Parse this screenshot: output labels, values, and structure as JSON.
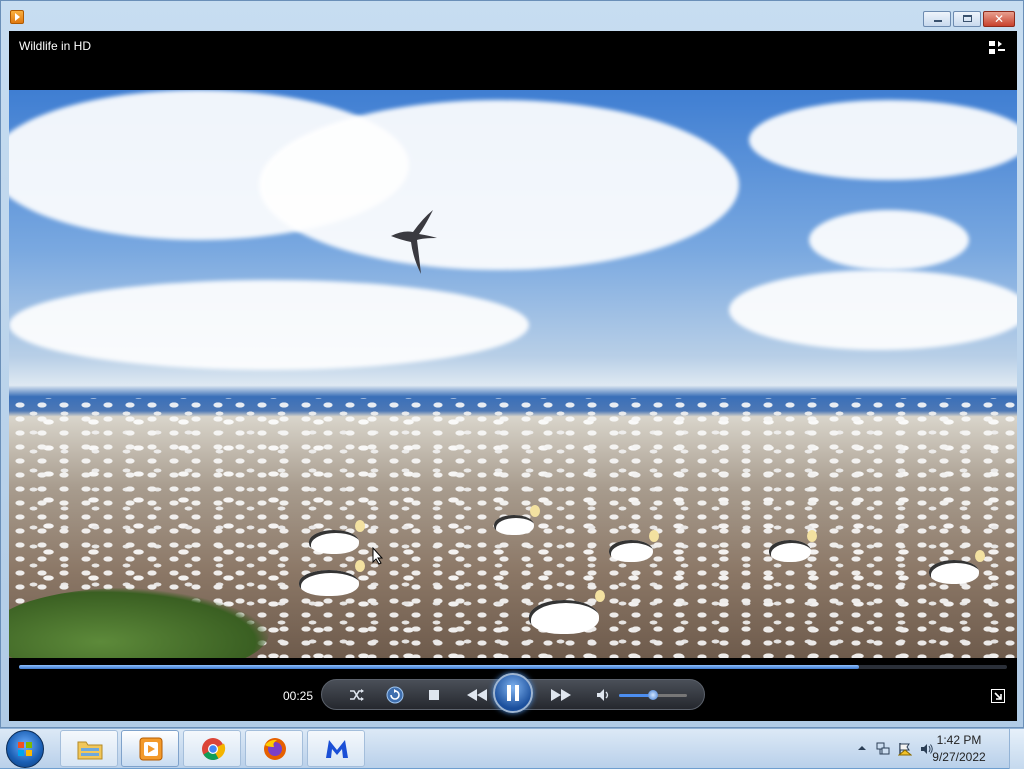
{
  "window": {
    "video_title": "Wildlife in HD"
  },
  "controls": {
    "elapsed": "00:25",
    "seek_progress_fraction": 0.85,
    "volume_fraction": 0.5,
    "state": "playing"
  },
  "taskbar": {
    "apps": [
      {
        "name": "file-explorer",
        "icon": "folder-icon"
      },
      {
        "name": "windows-media-player",
        "icon": "media-player-icon",
        "active": true
      },
      {
        "name": "chrome",
        "icon": "chrome-icon"
      },
      {
        "name": "firefox",
        "icon": "firefox-icon"
      },
      {
        "name": "malwarebytes",
        "icon": "malwarebytes-icon"
      }
    ],
    "clock": {
      "time": "1:42 PM",
      "date": "9/27/2022"
    }
  },
  "colors": {
    "accent": "#3e78cc",
    "close_button": "#c8412c"
  }
}
